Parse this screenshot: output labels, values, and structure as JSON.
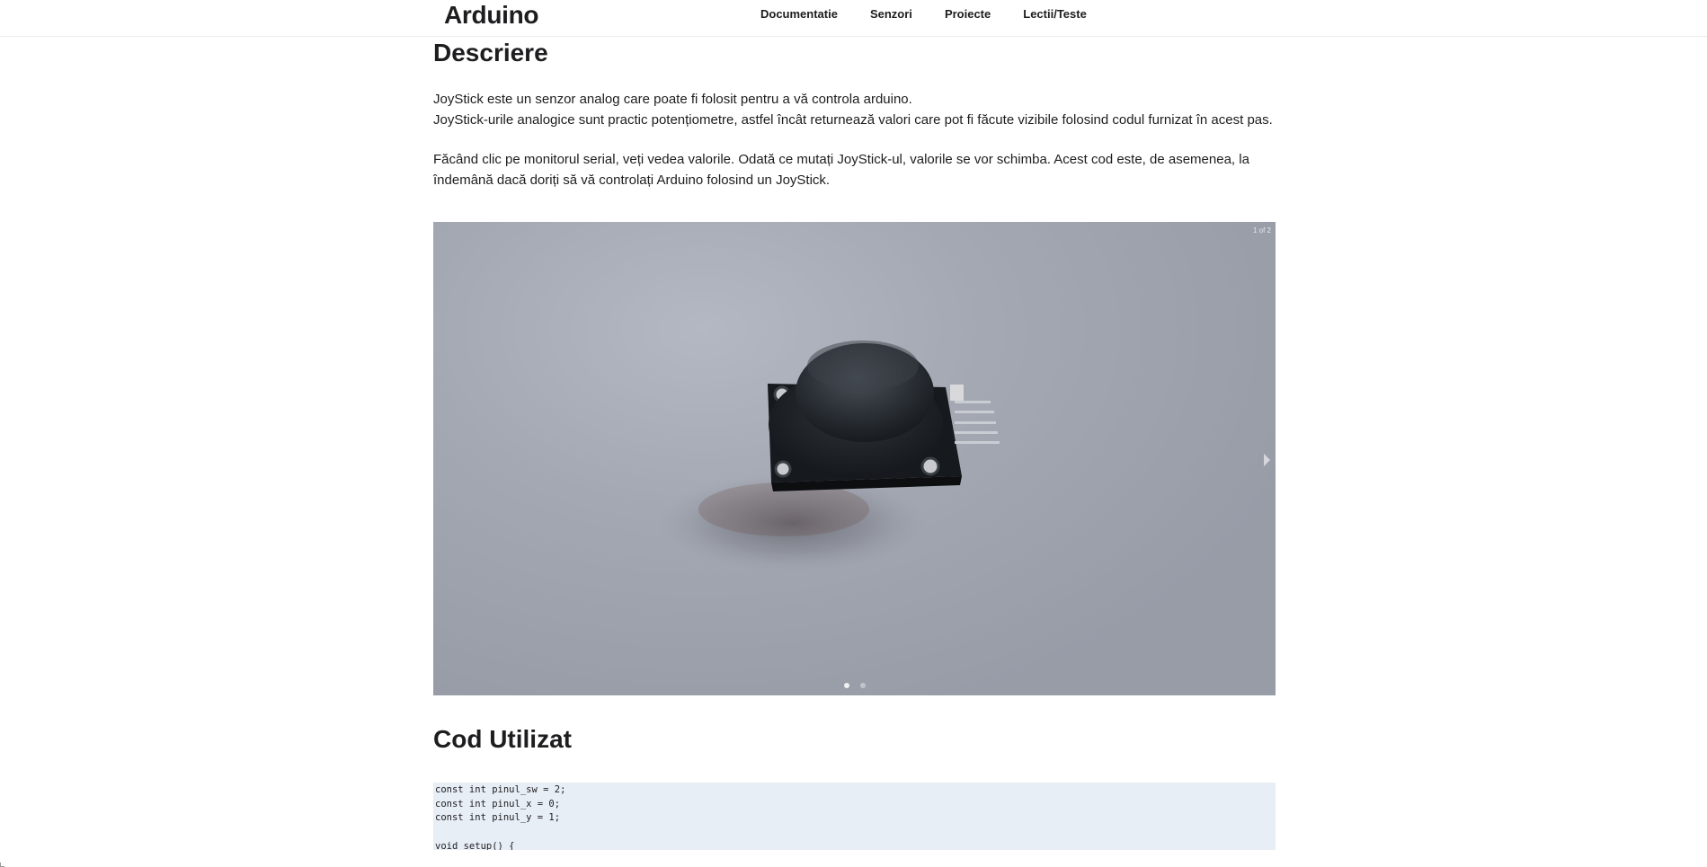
{
  "navbar": {
    "brand": "Arduino",
    "links": [
      "Documentatie",
      "Senzori",
      "Proiecte",
      "Lectii/Teste"
    ]
  },
  "description": {
    "heading": "Descriere",
    "line1": "JoyStick este un senzor analog care poate fi folosit pentru a vă controla arduino.",
    "line2": "JoyStick-urile analogice sunt practic potențiometre, astfel încât returnează valori care pot fi făcute vizibile folosind codul furnizat în acest pas.",
    "line3": "Făcând clic pe monitorul serial, veți vedea valorile. Odată ce mutați JoyStick-ul, valorile se vor schimba. Acest cod este, de asemenea, la îndemână dacă doriți să vă controlați Arduino folosind un JoyStick."
  },
  "slideshow": {
    "counter": "1 of 2",
    "current_slide": 1,
    "total_slides": 2
  },
  "code_section": {
    "heading": "Cod Utilizat",
    "code": "const int pinul_sw = 2;\nconst int pinul_x = 0;\nconst int pinul_y = 1;\n\nvoid setup() {"
  },
  "colors": {
    "code_background": "#e8eef6",
    "text": "#1d1d1f",
    "photo_background": "#a4a8b2"
  }
}
